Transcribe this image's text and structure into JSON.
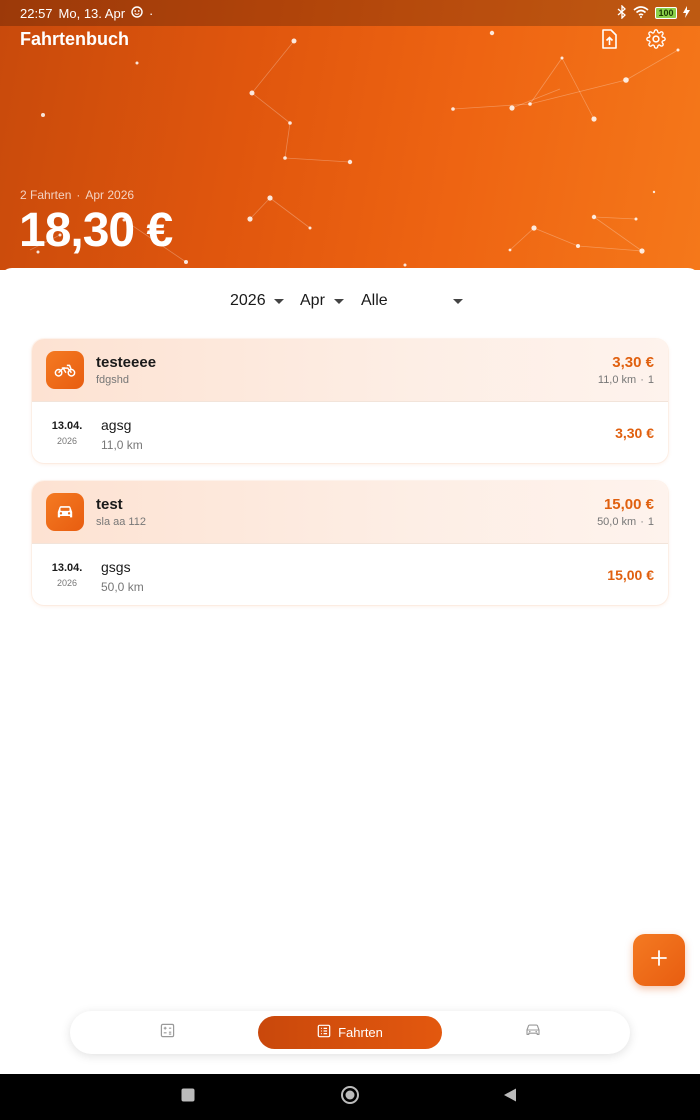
{
  "status_bar": {
    "time": "22:57",
    "date": "Mo, 13. Apr",
    "dot": "·",
    "battery": "100"
  },
  "header": {
    "title": "Fahrtenbuch",
    "export_icon": "file-upload-icon",
    "settings_icon": "gear-icon",
    "summary_trips": "2 Fahrten",
    "summary_sep": "·",
    "summary_period": "Apr 2026",
    "total": "18,30 €"
  },
  "filters": {
    "year": "2026",
    "month": "Apr",
    "vehicle": "Alle"
  },
  "groups": [
    {
      "icon": "motorcycle-icon",
      "name": "testeeee",
      "plate": "fdgshd",
      "total": "3,30 €",
      "distance": "11,0 km",
      "sep": "·",
      "count": "1",
      "trips": [
        {
          "date": "13.04.",
          "year": "2026",
          "name": "agsg",
          "distance": "11,0 km",
          "amount": "3,30 €"
        }
      ]
    },
    {
      "icon": "car-icon",
      "name": "test",
      "plate": "sla aa 112",
      "total": "15,00 €",
      "distance": "50,0 km",
      "sep": "·",
      "count": "1",
      "trips": [
        {
          "date": "13.04.",
          "year": "2026",
          "name": "gsgs",
          "distance": "50,0 km",
          "amount": "15,00 €"
        }
      ]
    }
  ],
  "fab": {
    "icon": "plus-icon"
  },
  "bottom_nav": {
    "left_icon": "calculator-icon",
    "active_label": "Fahrten",
    "active_icon": "list-icon",
    "right_icon": "car-icon"
  },
  "colors": {
    "accent": "#e85d10",
    "accent_dark": "#c9480c",
    "amount": "#e0600f"
  }
}
